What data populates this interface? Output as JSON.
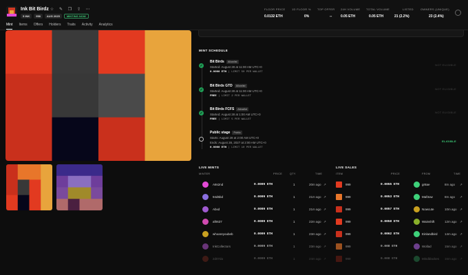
{
  "header": {
    "title": "Ink Bit Birdz",
    "chips": [
      "5 INK",
      "958",
      "AUG 2025"
    ],
    "minting_chip": "MINTING NOW",
    "icons": [
      "star-icon",
      "edit-icon",
      "copy-icon",
      "share-icon",
      "more-icon"
    ],
    "stats": [
      {
        "label": "FLOOR PRICE",
        "value": "0.0132 ETH"
      },
      {
        "label": "1D FLOOR %",
        "value": "0%"
      },
      {
        "label": "TOP OFFER",
        "value": "--"
      },
      {
        "label": "24H VOLUME",
        "value": "0.05 ETH"
      },
      {
        "label": "TOTAL VOLUME",
        "value": "0.05 ETH"
      },
      {
        "label": "LISTED",
        "value": "21 (2.2%)"
      },
      {
        "label": "OWNERS (UNIQUE)",
        "value": "23 (2.4%)"
      }
    ]
  },
  "tabs": [
    "Mint",
    "Items",
    "Offers",
    "Holders",
    "Traits",
    "Activity",
    "Analytics"
  ],
  "active_tab": "Mint",
  "art_colors": {
    "main": [
      [
        "#e23a20",
        "#3a3a3a",
        "#e23a20",
        "#e8a43c"
      ],
      [
        "#c9301c",
        "#383838",
        "#4a4a4a",
        "#e8a43c"
      ],
      [
        "#c9301c",
        "#06061a",
        "#c9301c",
        "#e8a43c"
      ]
    ],
    "thumb1": [
      [
        "#c9301c",
        "#e8762a",
        "#e8762a",
        "#e8a43c"
      ],
      [
        "#c9301c",
        "#383838",
        "#e23a20",
        "#e8a43c"
      ],
      [
        "#e23a20",
        "#06061a",
        "#e23a20",
        "#e8a43c"
      ]
    ],
    "thumb2": [
      [
        "#3b2a8a",
        "#3b2a8a",
        "#3b2a8a",
        "#3b2a8a"
      ],
      [
        "#6e3d9b",
        "#8a6fc0",
        "#8a6fc0",
        "#6e3d9b"
      ],
      [
        "#7a4a9c",
        "#a08a2a",
        "#a08a2a",
        "#7a4a9c"
      ],
      [
        "#b06a6a",
        "#4a2040",
        "#b06a6a",
        "#b06a6a"
      ]
    ]
  },
  "mint_schedule": {
    "title": "MINT SCHEDULE",
    "stages": [
      {
        "title": "Bit Birds",
        "tag": "Allowlist",
        "line1": "Started: August 28 at 11:00 AM UTC+0",
        "price": "0.0000 ETH",
        "limit": "LIMIT 50 PER WALLET",
        "status": "NOT ELIGIBLE"
      },
      {
        "title": "Bit Birds GTD",
        "tag": "Allowlist",
        "line1": "Started: August 28 at 11:00 AM UTC+0",
        "price": "FREE",
        "limit": "LIMIT 2 PER WALLET",
        "status": "NOT ELIGIBLE"
      },
      {
        "title": "Bit Birds FCFS",
        "tag": "Allowlist",
        "line1": "Started: August 28 at 1:00 AM UTC+0",
        "price": "FREE",
        "limit": "LIMIT 5 PER WALLET",
        "status": "NOT ELIGIBLE"
      },
      {
        "title": "Public stage",
        "tag": "Public",
        "line1": "Starts: August 28 at 2:00 AM UTC+0",
        "line2": "Ends: August 28, 2027 at 2:00 AM UTC+0",
        "price": "0.0000 ETH",
        "limit": "LIMIT 10 PER WALLET",
        "status": "ELIGIBLE"
      }
    ]
  },
  "live_mints": {
    "title": "LIVE MINTS",
    "headers": {
      "minter": "MINTER",
      "price": "PRICE",
      "qty": "QTY",
      "time": "TIME"
    },
    "rows": [
      {
        "minter": "A8s2nd",
        "price": "0.0009 ETH",
        "qty": "1",
        "time": "20m ago",
        "avatar": "#e34ad6"
      },
      {
        "minter": "94d6bd",
        "price": "0.0009 ETH",
        "qty": "1",
        "time": "21m ago",
        "avatar": "#8a6fe0"
      },
      {
        "minter": "Abxd",
        "price": "0.0009 ETH",
        "qty": "1",
        "time": "21m ago",
        "avatar": "#a05ad0"
      },
      {
        "minter": "af0637",
        "price": "0.0009 ETH",
        "qty": "1",
        "time": "22m ago",
        "avatar": "#d04ab0"
      },
      {
        "minter": "whoareyoubeb",
        "price": "0.0009 ETH",
        "qty": "1",
        "time": "23m ago",
        "avatar": "#c8a020"
      },
      {
        "minter": "InkCollectors",
        "price": "0.0009 ETH",
        "qty": "1",
        "time": "23m ago",
        "avatar": "#9a4ab0"
      },
      {
        "minter": "2d07da",
        "price": "0.0009 ETH",
        "qty": "1",
        "time": "24m ago",
        "avatar": "#b03a2a"
      }
    ]
  },
  "live_sales": {
    "title": "LIVE SALES",
    "headers": {
      "item": "ITEM",
      "price": "PRICE",
      "from": "FROM",
      "time": "TIME"
    },
    "rows": [
      {
        "item": "999",
        "price": "0.0055 ETH",
        "from": "gr8ae",
        "time": "8m ago",
        "avatar": "#3ed17a",
        "sq": "#e23a20"
      },
      {
        "item": "999",
        "price": "0.0053 ETH",
        "from": "Maf3ow",
        "time": "8m ago",
        "avatar": "#3ed17a",
        "sq": "#e8762a"
      },
      {
        "item": "999",
        "price": "0.0057 ETH",
        "from": "Nowcute",
        "time": "10m ago",
        "avatar": "#c8a020",
        "sq": "#c9301c"
      },
      {
        "item": "999",
        "price": "0.0058 ETH",
        "from": "Wainshift",
        "time": "12m ago",
        "avatar": "#8ab02a",
        "sq": "#e23a20"
      },
      {
        "item": "999",
        "price": "0.0062 ETH",
        "from": "Einlandbird",
        "time": "14m ago",
        "avatar": "#3ed17a",
        "sq": "#c9301c"
      },
      {
        "item": "999",
        "price": "0.008 ETH",
        "from": "Wollad",
        "time": "15m ago",
        "avatar": "#a05ad0",
        "sq": "#e8762a"
      },
      {
        "item": "999",
        "price": "0.008 ETH",
        "from": "Mindblackes",
        "time": "16m ago",
        "avatar": "#3ed17a",
        "sq": "#c9301c"
      }
    ]
  }
}
